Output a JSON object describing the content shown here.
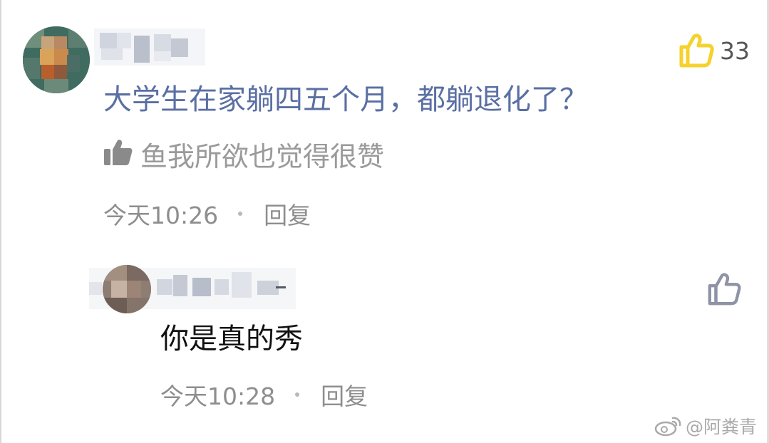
{
  "comments": [
    {
      "user_name": "",
      "text": "大学生在家躺四五个月，都躺退化了？",
      "liked_by_text": "鱼我所欲也觉得很赞",
      "time": "今天10:26",
      "reply_label": "回复",
      "like_count": "33",
      "liked": true
    },
    {
      "user_name": "",
      "text": "你是真的秀",
      "time": "今天10:28",
      "reply_label": "回复",
      "liked": false
    }
  ],
  "watermark": {
    "text": "@阿粪青",
    "icon": "weibo-logo-icon"
  },
  "colors": {
    "link_text": "#5a6fa3",
    "like_active": "#f5d22c",
    "like_inactive": "#8e93a6",
    "meta_text": "#8e8e8e"
  }
}
